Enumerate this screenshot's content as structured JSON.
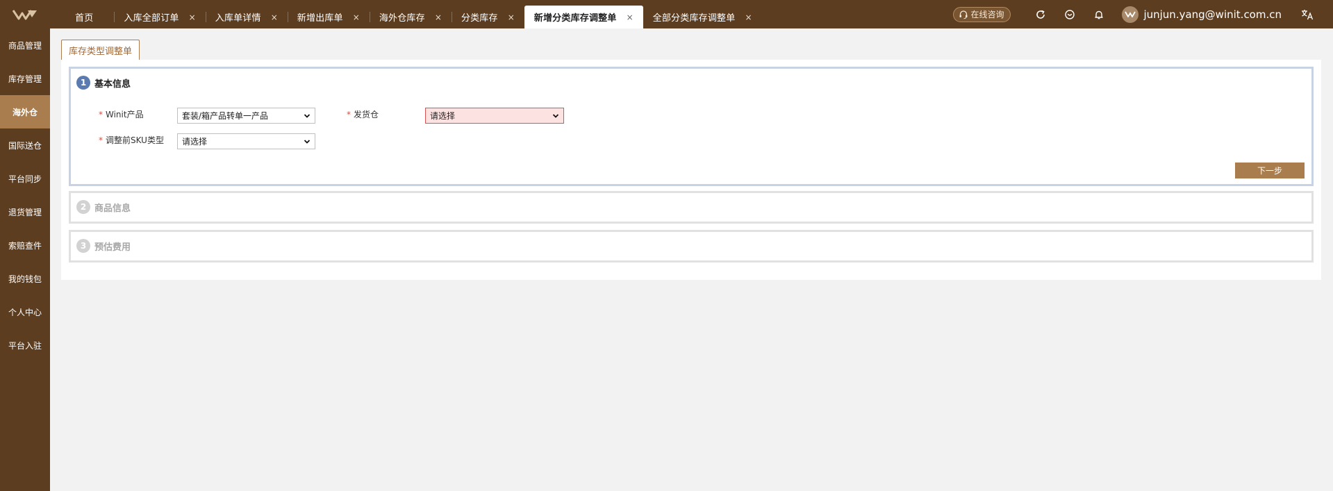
{
  "header": {
    "tabs": [
      {
        "label": "首页",
        "closable": false,
        "active": false
      },
      {
        "label": "入库全部订单",
        "closable": true,
        "active": false
      },
      {
        "label": "入库单详情",
        "closable": true,
        "active": false
      },
      {
        "label": "新增出库单",
        "closable": true,
        "active": false
      },
      {
        "label": "海外仓库存",
        "closable": true,
        "active": false
      },
      {
        "label": "分类库存",
        "closable": true,
        "active": false
      },
      {
        "label": "新增分类库存调整单",
        "closable": true,
        "active": true
      },
      {
        "label": "全部分类库存调整单",
        "closable": true,
        "active": false
      }
    ],
    "close_glyph": "×",
    "consult_label": "在线咨询",
    "user_email": "junjun.yang@winit.com.cn",
    "icons": [
      "headset-icon",
      "refresh-icon",
      "favorite-icon",
      "bell-icon",
      "translate-icon"
    ]
  },
  "sidebar": {
    "items": [
      {
        "label": "商品管理",
        "active": false
      },
      {
        "label": "库存管理",
        "active": false
      },
      {
        "label": "海外仓",
        "active": true
      },
      {
        "label": "国际送仓",
        "active": false
      },
      {
        "label": "平台同步",
        "active": false
      },
      {
        "label": "退货管理",
        "active": false
      },
      {
        "label": "索赔查件",
        "active": false
      },
      {
        "label": "我的钱包",
        "active": false
      },
      {
        "label": "个人中心",
        "active": false
      },
      {
        "label": "平台入驻",
        "active": false
      }
    ]
  },
  "page": {
    "tab_label": "库存类型调整单"
  },
  "sections": [
    {
      "num": "1",
      "title": "基本信息",
      "active": true
    },
    {
      "num": "2",
      "title": "商品信息",
      "active": false
    },
    {
      "num": "3",
      "title": "预估费用",
      "active": false
    }
  ],
  "form": {
    "required_mark": "*",
    "winit_product": {
      "label": "Winit产品",
      "value": "套装/箱产品转单一产品"
    },
    "warehouse": {
      "label": "发货仓",
      "value": "请选择",
      "error": true
    },
    "sku_type": {
      "label": "调整前SKU类型",
      "value": "请选择"
    },
    "next_label": "下一步"
  },
  "colors": {
    "brand_dark": "#5d3d1f",
    "brand_accent": "#a97d4e",
    "step_active": "#5b7bb0",
    "error_bg": "#fde2e2"
  }
}
